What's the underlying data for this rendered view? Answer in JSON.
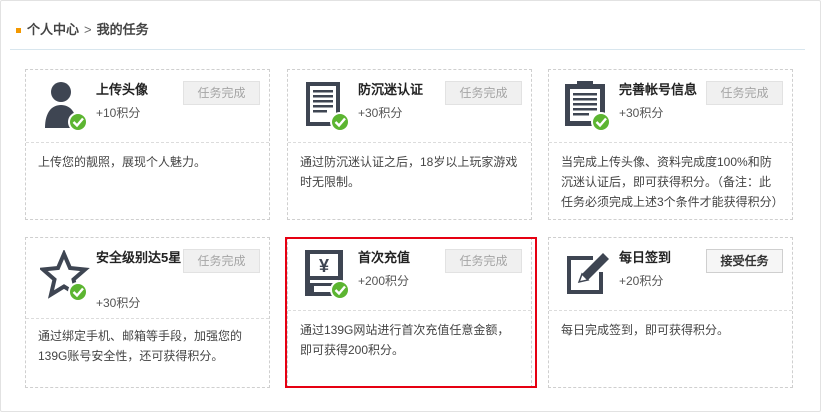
{
  "breadcrumb": {
    "parent": "个人中心",
    "separator": ">",
    "current": "我的任务"
  },
  "tasks": [
    {
      "icon": "avatar-user-icon",
      "title": "上传头像",
      "points": "+10积分",
      "button": "任务完成",
      "button_state": "completed",
      "desc": "上传您的靓照，展现个人魅力。"
    },
    {
      "icon": "anti-addiction-document-icon",
      "title": "防沉迷认证",
      "points": "+30积分",
      "button": "任务完成",
      "button_state": "completed",
      "desc": "通过防沉迷认证之后，18岁以上玩家游戏时无限制。"
    },
    {
      "icon": "account-info-clipboard-icon",
      "title": "完善帐号信息",
      "points": "+30积分",
      "button": "任务完成",
      "button_state": "completed",
      "desc": "当完成上传头像、资料完成度100%和防沉迷认证后，即可获得积分。（备注：此任务必须完成上述3个条件才能获得积分）"
    },
    {
      "icon": "security-star-icon",
      "title": "安全级别达5星",
      "points": "+30积分",
      "button": "任务完成",
      "button_state": "completed",
      "desc": "通过绑定手机、邮箱等手段，加强您的139G账号安全性，还可获得积分。"
    },
    {
      "icon": "recharge-atm-yen-icon",
      "title": "首次充值",
      "points": "+200积分",
      "button": "任务完成",
      "button_state": "completed",
      "desc": "通过139G网站进行首次充值任意金额，即可获得200积分。"
    },
    {
      "icon": "daily-signin-pen-icon",
      "title": "每日签到",
      "points": "+20积分",
      "button": "接受任务",
      "button_state": "available",
      "desc": "每日完成签到，即可获得积分。"
    }
  ],
  "colors": {
    "accent_marker": "#f39800",
    "icon_dark": "#3e4552",
    "check_green": "#5cb531",
    "highlight_border": "#e60012",
    "disabled_button_text": "#a5a5a5"
  }
}
